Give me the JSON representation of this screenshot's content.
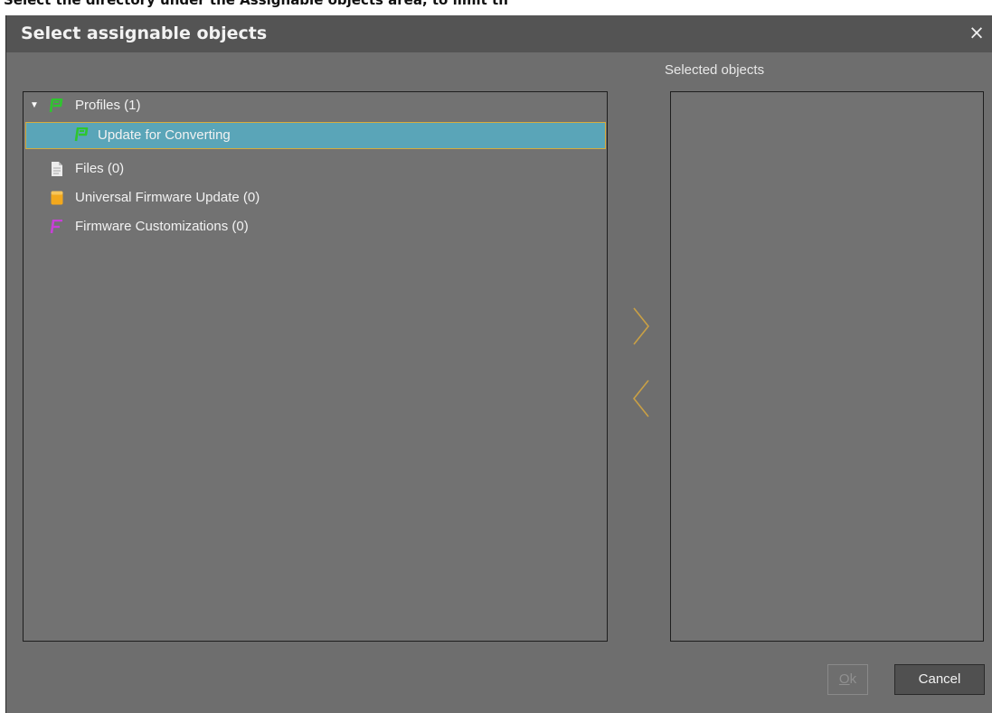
{
  "caption": "Select the directory under the Assignable objects area, to limit th",
  "dialog": {
    "title": "Select assignable objects",
    "close_label": "×"
  },
  "tree": {
    "profiles": {
      "label": "Profiles (1)",
      "expanded": true,
      "icon": "profile-icon",
      "color": "#2ec62e"
    },
    "profile_child": {
      "label": "Update for Converting",
      "selected": true,
      "icon": "profile-icon",
      "color": "#2ec62e"
    },
    "files": {
      "label": "Files (0)",
      "icon": "file-icon"
    },
    "universal_firmware": {
      "label": "Universal Firmware Update (0)",
      "icon": "firmware-update-icon",
      "color": "#f2a81d"
    },
    "firmware_customizations": {
      "label": "Firmware Customizations (0)",
      "icon": "customization-icon",
      "color": "#c83fd8"
    }
  },
  "selected_objects": {
    "label": "Selected objects",
    "items": []
  },
  "buttons": {
    "ok_mnemonic": "O",
    "ok_rest": "k",
    "ok_enabled": false,
    "cancel": "Cancel"
  },
  "colors": {
    "accent": "#d6ad3d",
    "selection": "#5aa5b8",
    "arrow": "#c9a045"
  }
}
